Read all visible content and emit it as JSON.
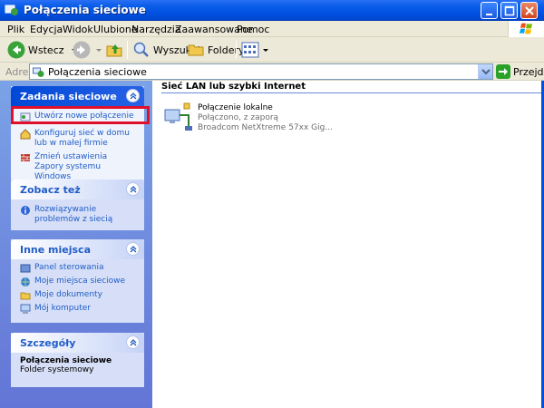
{
  "window": {
    "title": "Połączenia sieciowe"
  },
  "menu": [
    "Plik",
    "Edycja",
    "Widok",
    "Ulubione",
    "Narzędzia",
    "Zaawansowane",
    "Pomoc"
  ],
  "toolbar": {
    "back_label": "Wstecz",
    "search_label": "Wyszukaj",
    "folders_label": "Foldery"
  },
  "address": {
    "label": "Adres",
    "value": "Połączenia sieciowe",
    "go_label": "Przejdź"
  },
  "panels": {
    "tasks": {
      "title": "Zadania sieciowe",
      "items": [
        "Utwórz nowe połączenie",
        "Konfiguruj sieć w domu lub w małej firmie",
        "Zmień ustawienia Zapory systemu Windows"
      ]
    },
    "see_also": {
      "title": "Zobacz też",
      "items": [
        "Rozwiązywanie problemów z siecią"
      ]
    },
    "other_places": {
      "title": "Inne miejsca",
      "items": [
        "Panel sterowania",
        "Moje miejsca sieciowe",
        "Moje dokumenty",
        "Mój komputer"
      ]
    },
    "details": {
      "title": "Szczegóły",
      "name": "Połączenia sieciowe",
      "type": "Folder systemowy"
    }
  },
  "main": {
    "group_title": "Sieć LAN lub szybki Internet",
    "connection": {
      "name": "Połączenie lokalne",
      "status": "Połączono, z zaporą",
      "device": "Broadcom NetXtreme 57xx Gig..."
    }
  },
  "colors": {
    "titlebar": "#0050e0",
    "panel_link": "#215dc6",
    "highlight": "#e0102a"
  }
}
